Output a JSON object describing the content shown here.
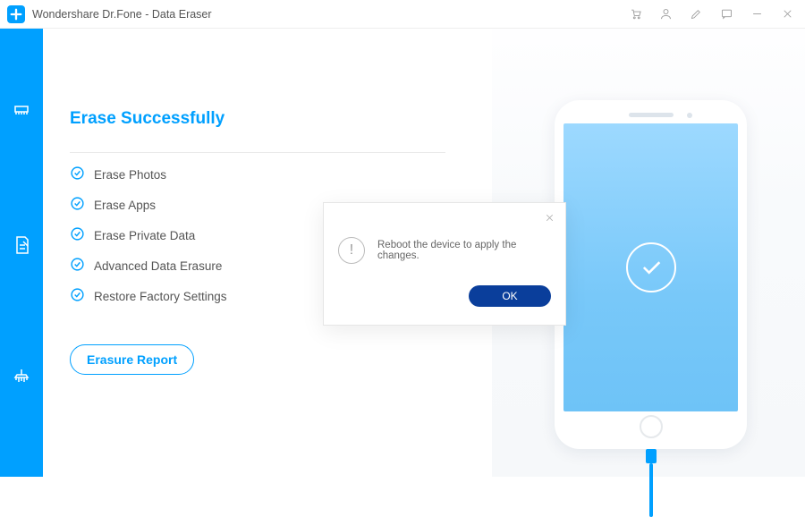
{
  "titlebar": {
    "title": "Wondershare Dr.Fone - Data Eraser"
  },
  "heading": "Erase Successfully",
  "items": [
    "Erase Photos",
    "Erase Apps",
    "Erase Private Data",
    "Advanced Data Erasure",
    "Restore Factory Settings"
  ],
  "report_button": "Erasure Report",
  "dialog": {
    "message": "Reboot the device to apply the changes.",
    "ok": "OK"
  },
  "colors": {
    "accent": "#00a0ff",
    "dialog_ok": "#0a3e9b"
  }
}
